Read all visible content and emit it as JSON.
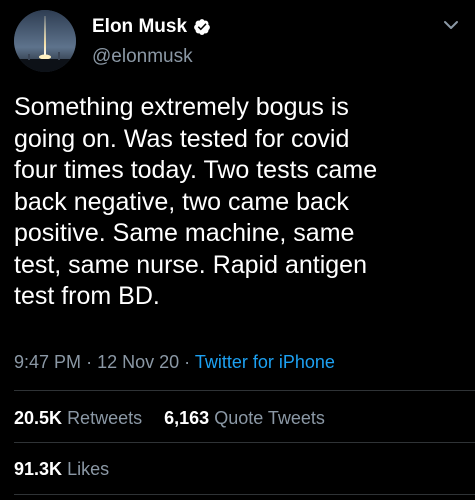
{
  "author": {
    "display_name": "Elon Musk",
    "handle": "@elonmusk",
    "verified": true,
    "avatar_icon": "rocket-launch-avatar"
  },
  "tweet": {
    "text_lines": [
      "Something extremely bogus is",
      "going on. Was tested for covid",
      "four times today. Two tests came",
      "back negative, two came back",
      "positive. Same machine, same",
      "test, same nurse. Rapid antigen",
      "test from BD."
    ],
    "time": "9:47 PM",
    "date": "12 Nov 20",
    "separator": "·",
    "source": "Twitter for iPhone"
  },
  "stats": {
    "retweets_count": "20.5K",
    "retweets_label": "Retweets",
    "quote_tweets_count": "6,163",
    "quote_tweets_label": "Quote Tweets",
    "likes_count": "91.3K",
    "likes_label": "Likes"
  },
  "colors": {
    "background": "#000000",
    "text_primary": "#ffffff",
    "text_secondary": "#8b98a5",
    "link": "#1da1f2",
    "divider": "#2f3336"
  },
  "icons": {
    "verified": "verified-badge-icon",
    "more": "chevron-down-icon"
  }
}
